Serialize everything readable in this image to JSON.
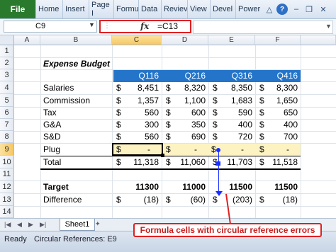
{
  "ribbon": {
    "file_label": "File",
    "tabs": [
      "Home",
      "Insert",
      "Page I",
      "Formu",
      "Data",
      "Reviev",
      "View",
      "Devel",
      "Power"
    ]
  },
  "formula_bar": {
    "name_box": "C9",
    "fx_label": "fx",
    "formula": "=C13"
  },
  "grid": {
    "columns": [
      "A",
      "B",
      "C",
      "D",
      "E",
      "F"
    ],
    "rows": [
      "1",
      "2",
      "3",
      "4",
      "5",
      "6",
      "7",
      "8",
      "9",
      "10",
      "11",
      "12",
      "13",
      "14"
    ],
    "selected_column": "C",
    "selected_row": "9"
  },
  "sheet": {
    "title": "Expense Budget",
    "quarters": [
      "Q116",
      "Q216",
      "Q316",
      "Q416"
    ],
    "currency": "$",
    "line_items": [
      {
        "label": "Salaries",
        "values": [
          "8,451",
          "8,320",
          "8,350",
          "8,300"
        ]
      },
      {
        "label": "Commission",
        "values": [
          "1,357",
          "1,100",
          "1,683",
          "1,650"
        ]
      },
      {
        "label": "Tax",
        "values": [
          "560",
          "600",
          "590",
          "650"
        ]
      },
      {
        "label": "G&A",
        "values": [
          "300",
          "350",
          "400",
          "400"
        ]
      },
      {
        "label": "S&D",
        "values": [
          "560",
          "690",
          "720",
          "700"
        ]
      },
      {
        "label": "Plug",
        "values": [
          "-",
          "-",
          "-",
          "-"
        ]
      }
    ],
    "total": {
      "label": "Total",
      "values": [
        "11,318",
        "11,060",
        "11,703",
        "11,518"
      ]
    },
    "target": {
      "label": "Target",
      "values": [
        "11300",
        "11000",
        "11500",
        "11500"
      ]
    },
    "difference": {
      "label": "Difference",
      "values": [
        "(18)",
        "(60)",
        "(203)",
        "(18)"
      ]
    }
  },
  "sheet_tabs": {
    "active": "Sheet1"
  },
  "status": {
    "ready": "Ready",
    "circular": "Circular References: E9"
  },
  "callout": {
    "text": "Formula cells with circular reference errors"
  },
  "colors": {
    "accent_header": "#2475c9",
    "plug_highlight": "#fdf3c2",
    "callout_red": "#e02020",
    "trace_blue": "#1a2dff",
    "file_tab": "#2a7a2e"
  }
}
